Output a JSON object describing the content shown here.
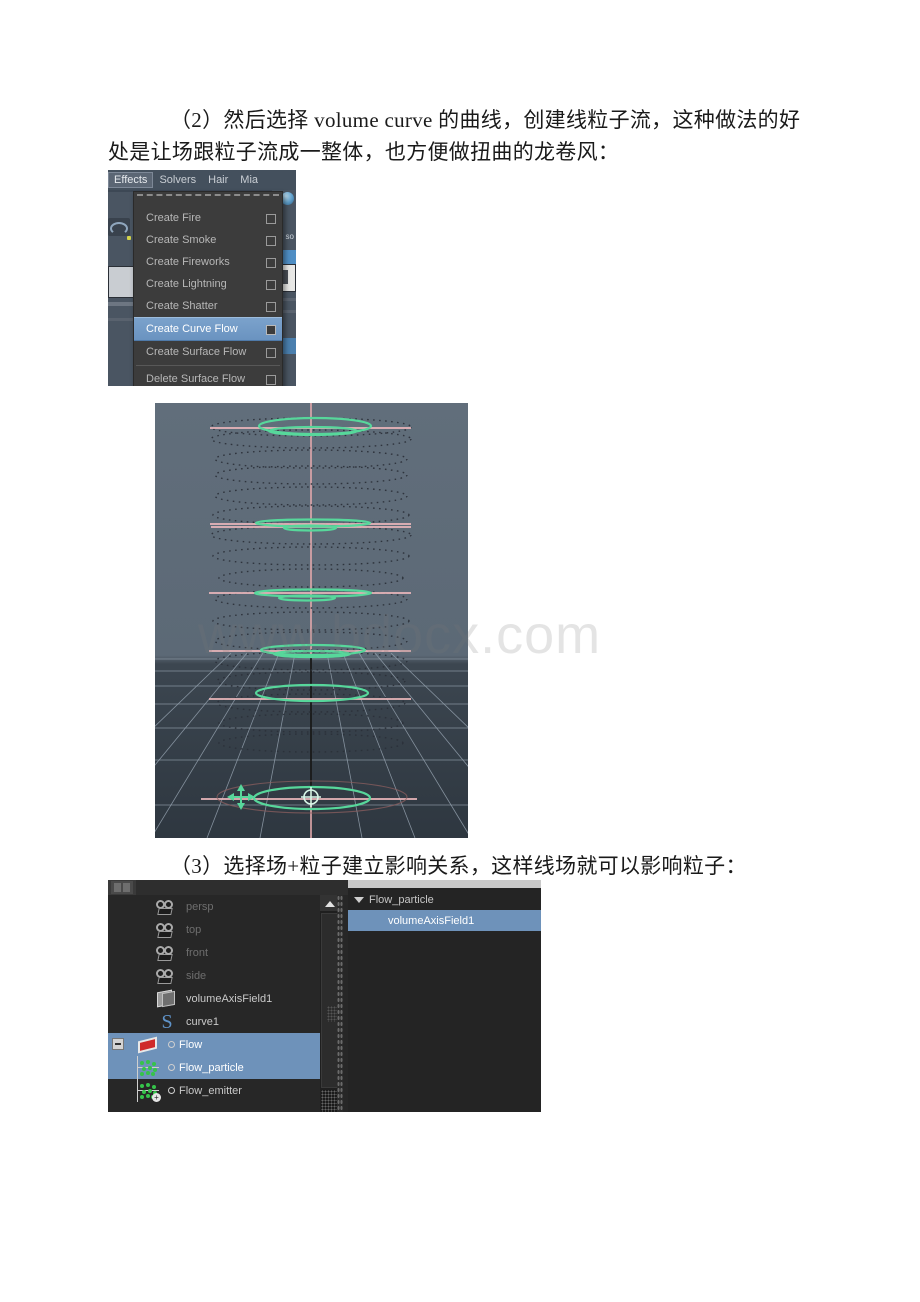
{
  "document": {
    "paragraph_2": "（2）然后选择 volume curve 的曲线，创建线粒子流，这种做法的好处是让场跟粒子流成一整体，也方便做扭曲的龙卷风：",
    "paragraph_3": "（3）选择场+粒子建立影响关系，这样线场就可以影响粒子："
  },
  "watermark": {
    "text": "www.bdocx.com",
    "color": "#787878"
  },
  "effects_menu": {
    "menubar": [
      {
        "label": "Effects",
        "active": true
      },
      {
        "label": "Solvers",
        "active": false
      },
      {
        "label": "Hair",
        "active": false
      },
      {
        "label": "Mia",
        "active": false
      }
    ],
    "items": [
      {
        "label": "Create Fire",
        "selected": false,
        "option_box": true
      },
      {
        "label": "Create Smoke",
        "selected": false,
        "option_box": true
      },
      {
        "label": "Create Fireworks",
        "selected": false,
        "option_box": true
      },
      {
        "label": "Create Lightning",
        "selected": false,
        "option_box": true
      },
      {
        "label": "Create Shatter",
        "selected": false,
        "option_box": true
      },
      {
        "label": "Create Curve Flow",
        "selected": true,
        "option_box": true
      },
      {
        "label": "Create Surface Flow",
        "selected": false,
        "option_box": true
      },
      {
        "label": "Delete Surface Flow",
        "selected": false,
        "option_box": true
      }
    ],
    "colors": {
      "panel_bg": "#3c3c3c",
      "highlight": "#6a93c0",
      "text": "#b7b7b7",
      "app_bg": "#5b6573"
    },
    "side_label": "so"
  },
  "viewport": {
    "background": "#5e6b78",
    "grid_color": "#8d99a6",
    "curve_color": "#5fd7a0",
    "field_color": "#f2b8bc",
    "axis_color": "#c87f84",
    "ring_count": 13
  },
  "outliner": {
    "left_panel": {
      "items": [
        {
          "label": "persp",
          "icon": "camera-icon",
          "state": "dim",
          "selected": false,
          "indent": 0
        },
        {
          "label": "top",
          "icon": "camera-icon",
          "state": "dim",
          "selected": false,
          "indent": 0
        },
        {
          "label": "front",
          "icon": "camera-icon",
          "state": "dim",
          "selected": false,
          "indent": 0
        },
        {
          "label": "side",
          "icon": "camera-icon",
          "state": "dim",
          "selected": false,
          "indent": 0
        },
        {
          "label": "volumeAxisField1",
          "icon": "field-icon",
          "state": "bright",
          "selected": false,
          "indent": 0
        },
        {
          "label": "curve1",
          "icon": "curve-icon",
          "state": "bright",
          "selected": false,
          "indent": 0
        },
        {
          "label": "Flow",
          "icon": "flow-icon",
          "state": "bright",
          "selected": true,
          "indent": 0,
          "expandable": true
        },
        {
          "label": "Flow_particle",
          "icon": "particle-icon",
          "state": "bright",
          "selected": true,
          "indent": 1
        },
        {
          "label": "Flow_emitter",
          "icon": "emitter-icon",
          "state": "bright",
          "selected": false,
          "indent": 1
        }
      ]
    },
    "right_panel": {
      "items": [
        {
          "label": "Flow_particle",
          "selected": false,
          "expanded": true,
          "indent": 0
        },
        {
          "label": "volumeAxisField1",
          "selected": true,
          "expanded": false,
          "indent": 1
        }
      ]
    },
    "colors": {
      "selection": "#6e92ba",
      "panel_bg": "#272727",
      "text": "#c9c9c9"
    }
  }
}
